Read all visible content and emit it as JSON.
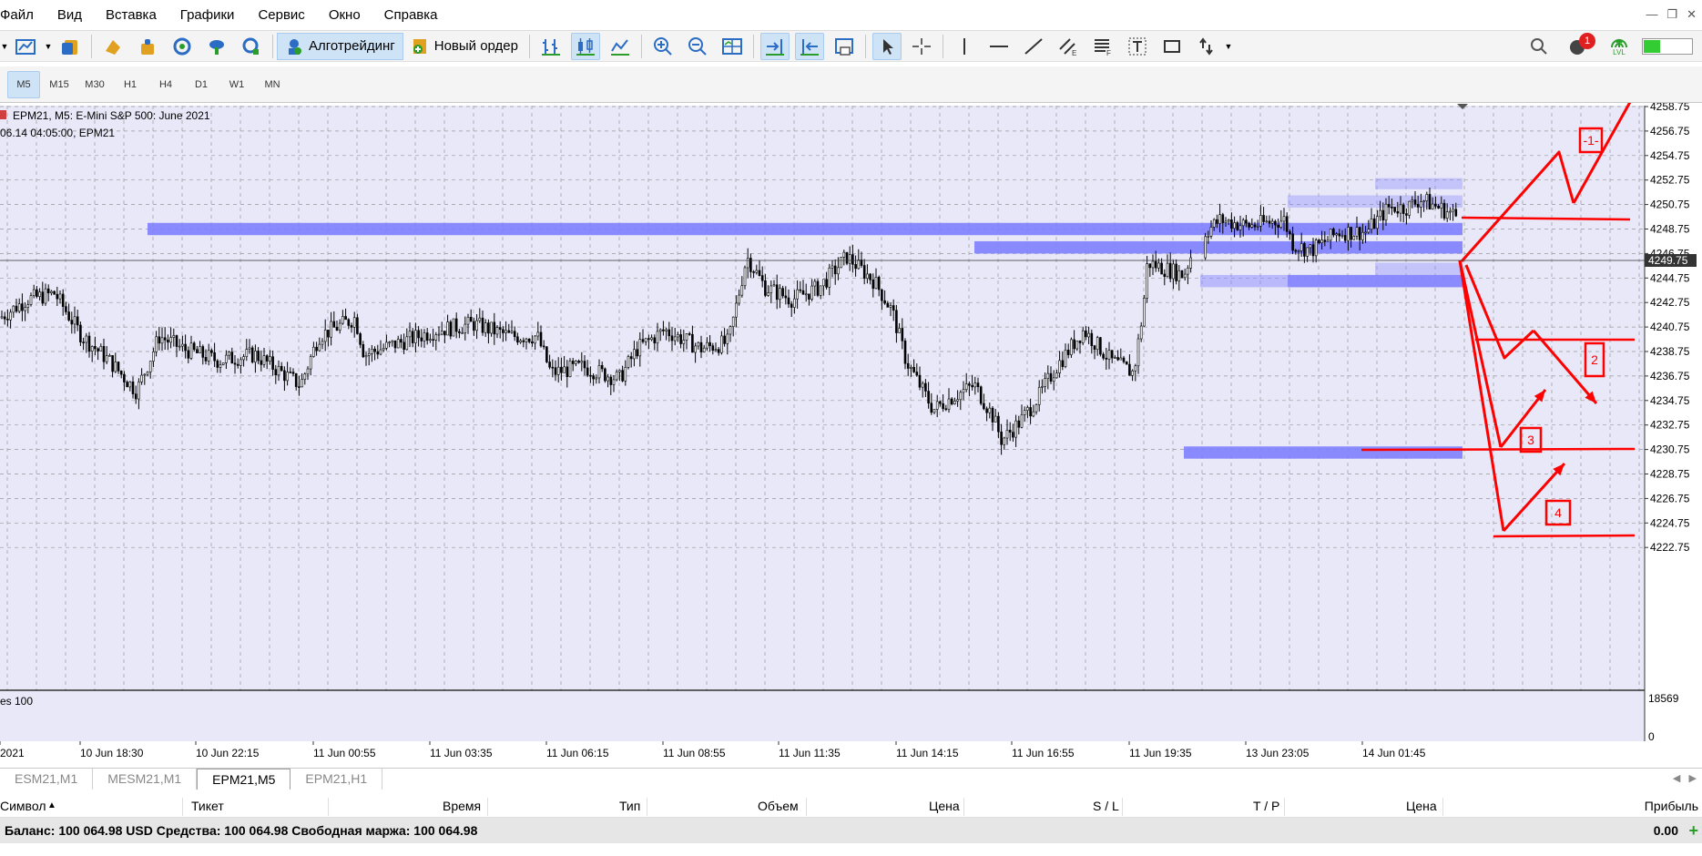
{
  "menu": [
    "Файл",
    "Вид",
    "Вставка",
    "Графики",
    "Сервис",
    "Окно",
    "Справка"
  ],
  "toolbar": {
    "algotrading_label": "Алготрейдинг",
    "new_order_label": "Новый ордер",
    "notification_count": "1",
    "lvl_label": "LVL"
  },
  "timeframes": [
    "M5",
    "M15",
    "M30",
    "H1",
    "H4",
    "D1",
    "W1",
    "MN"
  ],
  "active_timeframe": "M5",
  "chart": {
    "title": "EPM21, M5:  E-Mini S&P 500: June 2021",
    "subtitle": "06.14 04:05:00, EPM21",
    "current_price": "4249.75",
    "price_labels": [
      "4258.75",
      "4256.75",
      "4254.75",
      "4252.75",
      "4250.75",
      "4248.75",
      "4246.75",
      "4244.75",
      "4242.75",
      "4240.75",
      "4238.75",
      "4236.75",
      "4234.75",
      "4232.75",
      "4230.75",
      "4228.75",
      "4226.75",
      "4224.75",
      "4222.75"
    ],
    "time_labels": [
      "2021",
      "10 Jun 18:30",
      "10 Jun 22:15",
      "11 Jun 00:55",
      "11 Jun 03:35",
      "11 Jun 06:15",
      "11 Jun 08:55",
      "11 Jun 11:35",
      "11 Jun 14:15",
      "11 Jun 16:55",
      "11 Jun 19:35",
      "13 Jun 23:05",
      "14 Jun 01:45"
    ],
    "volume_label": "es 100",
    "volume_max": "18569",
    "volume_zero": "0",
    "annotations": [
      "-1-",
      "2",
      "3",
      "4"
    ],
    "colors": {
      "background": "#e8e8f8",
      "grid": "#999999",
      "zone": "#8080ff",
      "annotation": "#ff0000",
      "candles": "#000000",
      "vol_up": "#00a000",
      "vol_down": "#d00000"
    }
  },
  "tabs": [
    "ESM21,M1",
    "MESM21,M1",
    "EPM21,M5",
    "EPM21,H1"
  ],
  "active_tab": "EPM21,M5",
  "trade_columns": [
    "Символ",
    "Тикет",
    "Время",
    "Тип",
    "Объем",
    "Цена",
    "S / L",
    "T / P",
    "Цена",
    "Прибыль"
  ],
  "balance_line": "Баланс: 100 064.98 USD  Средства: 100 064.98  Свободная маржа: 100 064.98",
  "profit_total": "0.00"
}
